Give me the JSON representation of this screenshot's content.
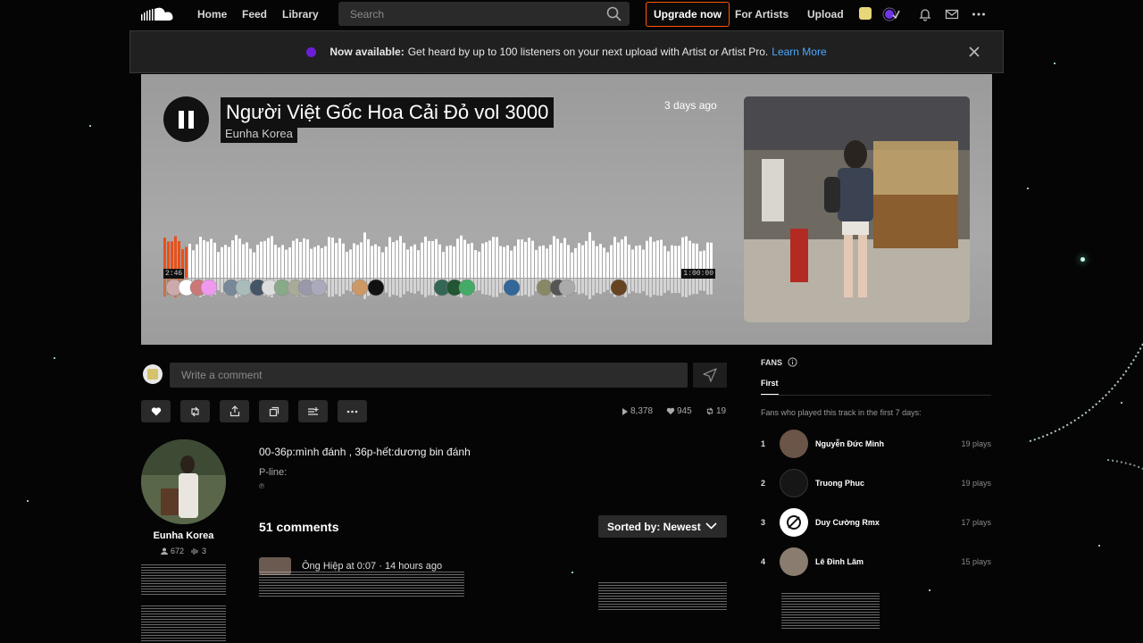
{
  "nav": {
    "home": "Home",
    "feed": "Feed",
    "library": "Library",
    "search_placeholder": "Search",
    "upgrade": "Upgrade now",
    "for_artists": "For Artists",
    "upload": "Upload"
  },
  "banner": {
    "bold": "Now available:",
    "text": "Get heard by up to 100 listeners on your next upload with Artist or Artist Pro.",
    "link": "Learn More"
  },
  "track": {
    "title": "Người Việt Gốc Hoa Cải Đỏ vol 3000",
    "artist": "Eunha Korea",
    "posted": "3 days ago",
    "elapsed": "2:46",
    "duration": "1:00:00",
    "progress": 0.045
  },
  "comment_box": {
    "placeholder": "Write a comment"
  },
  "stats": {
    "plays": "8,378",
    "likes": "945",
    "reposts": "19"
  },
  "artist": {
    "name": "Eunha Korea",
    "followers": "672",
    "tracks": "3"
  },
  "description": {
    "line1": "00-36p:mình đánh , 36p-hết:dương bin đánh",
    "pline": "P-line:",
    "symbol": "℗"
  },
  "comments": {
    "count": "51 comments",
    "sort": "Sorted by: Newest",
    "first_comment": "Ông Hiệp at 0:07 · 14 hours ago"
  },
  "fans": {
    "header": "FANS",
    "tab": "First",
    "subtitle": "Fans who played this track in the first 7 days:",
    "list": [
      {
        "rank": "1",
        "name": "Nguyễn Đức Minh",
        "plays": "19 plays"
      },
      {
        "rank": "2",
        "name": "Truong Phuc",
        "plays": "19 plays"
      },
      {
        "rank": "3",
        "name": "Duy Cường Rmx",
        "plays": "17 plays"
      },
      {
        "rank": "4",
        "name": "Lê Đình Lâm",
        "plays": "15 plays"
      }
    ]
  },
  "colors": {
    "accent": "#ff5500",
    "link": "#4aa8ff",
    "banner_dot": "#6a1fd6"
  }
}
